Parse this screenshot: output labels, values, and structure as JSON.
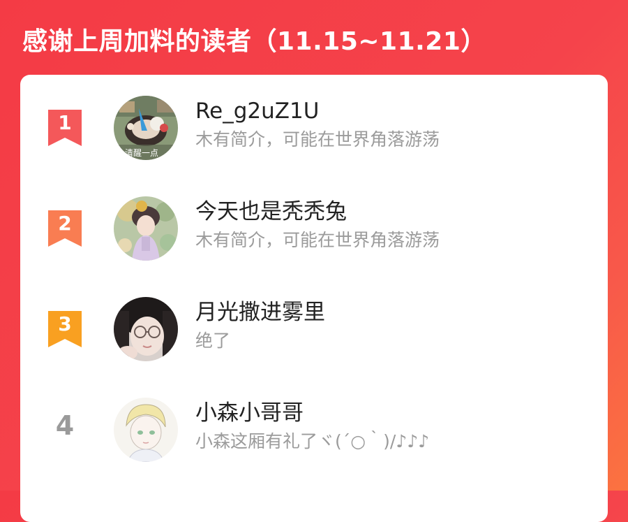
{
  "header": {
    "title": "感谢上周加料的读者（11.15~11.21）"
  },
  "colors": {
    "rank1": "#f4585a",
    "rank2": "#f97d52",
    "rank3": "#f9a021",
    "rank_plain": "#9a9a9a"
  },
  "readers": [
    {
      "rank": "1",
      "name": "Re_g2uZ1U",
      "bio": "木有简介，可能在世界角落游荡",
      "avatar_icon": "cartoon-avatar-icon",
      "avatar_caption": "清醒一点"
    },
    {
      "rank": "2",
      "name": "今天也是秃秃兔",
      "bio": "木有简介，可能在世界角落游荡",
      "avatar_icon": "illustrated-girl-avatar-icon"
    },
    {
      "rank": "3",
      "name": "月光撒进雾里",
      "bio": "绝了",
      "avatar_icon": "photo-girl-avatar-icon"
    },
    {
      "rank": "4",
      "name": "小森小哥哥",
      "bio": "小森这厢有礼了ヾ(´○｀)/♪♪♪",
      "avatar_icon": "sketch-boy-avatar-icon"
    }
  ]
}
